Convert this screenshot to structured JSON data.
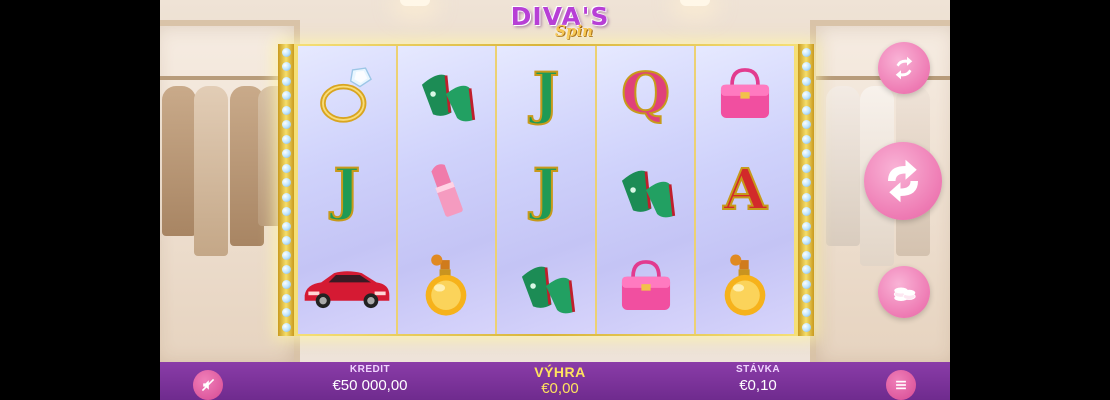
{
  "game": {
    "logo_main": "DIVA'S",
    "logo_sub": "Spin"
  },
  "reels": [
    [
      "diamond-ring",
      "letter-J",
      "red-sports-car"
    ],
    [
      "green-heels",
      "pink-lipstick",
      "perfume-bottle"
    ],
    [
      "letter-J",
      "letter-J",
      "green-heels"
    ],
    [
      "letter-Q",
      "green-heels",
      "pink-handbag"
    ],
    [
      "pink-handbag",
      "letter-A",
      "perfume-bottle"
    ]
  ],
  "letters": {
    "J": "J",
    "Q": "Q",
    "A": "A"
  },
  "bottom_bar": {
    "kredit_label": "KREDIT",
    "kredit_value": "€50 000,00",
    "vyhra_label": "VÝHRA",
    "vyhra_value": "€0,00",
    "stavka_label": "STÁVKA",
    "stavka_value": "€0,10"
  },
  "icons": {
    "sound": "sound-off-icon",
    "menu": "hamburger-menu-icon",
    "autoplay": "autoplay-arrows-icon",
    "spin": "spin-arrows-icon",
    "bet": "coins-stack-icon"
  },
  "colors": {
    "bar": "#7a3399",
    "button_pink": "#ee7ab3",
    "win_yellow": "#ffe25e"
  }
}
